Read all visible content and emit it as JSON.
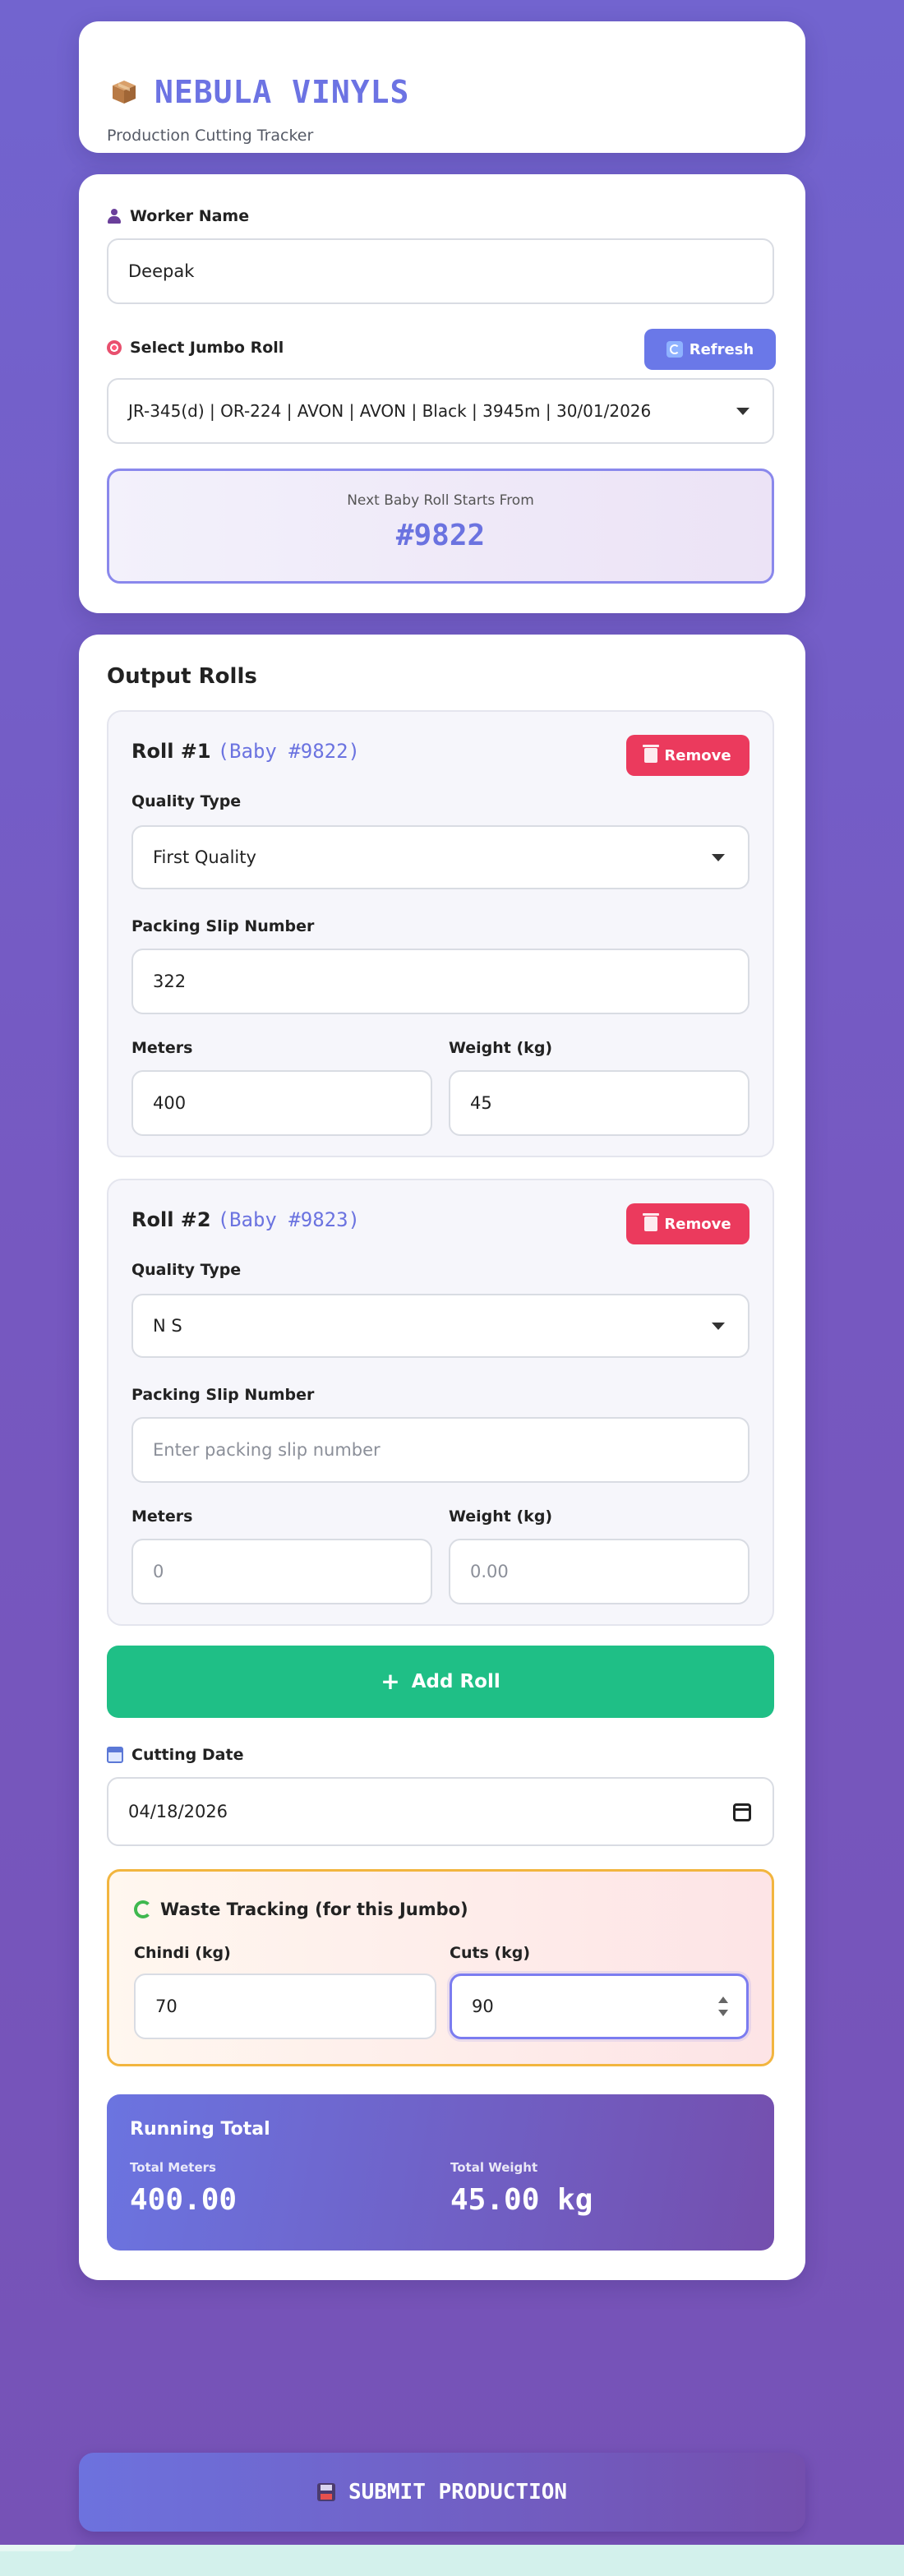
{
  "header": {
    "brand": "NEBULA VINYLS",
    "subtitle": "Production Cutting Tracker"
  },
  "worker": {
    "name_label": "Worker Name",
    "name_value": "Deepak",
    "jumbo_label": "Select Jumbo Roll",
    "refresh_label": "Refresh",
    "jumbo_selected": "JR-345(d) | OR-224 | AVON | AVON | Black | 3945m | 30/01/2026",
    "next_label": "Next Baby Roll Starts From",
    "next_value": "#9822"
  },
  "output": {
    "title": "Output Rolls",
    "remove_label": "Remove",
    "quality_label": "Quality Type",
    "slip_label": "Packing Slip Number",
    "meters_label": "Meters",
    "weight_label": "Weight (kg)",
    "rolls": [
      {
        "title": "Roll #1",
        "baby": "(Baby #9822)",
        "quality": "First Quality",
        "slip": "322",
        "meters": "400",
        "weight": "45"
      },
      {
        "title": "Roll #2",
        "baby": "(Baby #9823)",
        "quality": "N S",
        "slip_placeholder": "Enter packing slip number",
        "meters_placeholder": "0",
        "weight_placeholder": "0.00"
      }
    ],
    "add_roll_label": "Add Roll",
    "cutting_date_label": "Cutting Date",
    "cutting_date_value": "04/18/2026"
  },
  "waste": {
    "title": "Waste Tracking (for this Jumbo)",
    "chindi_label": "Chindi (kg)",
    "chindi_value": "70",
    "cuts_label": "Cuts (kg)",
    "cuts_value": "90"
  },
  "totals": {
    "title": "Running Total",
    "meters_label": "Total Meters",
    "meters_value": "400.00",
    "weight_label": "Total Weight",
    "weight_value": "45.00 kg"
  },
  "submit_label": "SUBMIT PRODUCTION",
  "colors": {
    "accent": "#6c73e3",
    "success": "#1fbf86",
    "danger": "#eb3a5d",
    "warning_border": "#f2b53f"
  }
}
